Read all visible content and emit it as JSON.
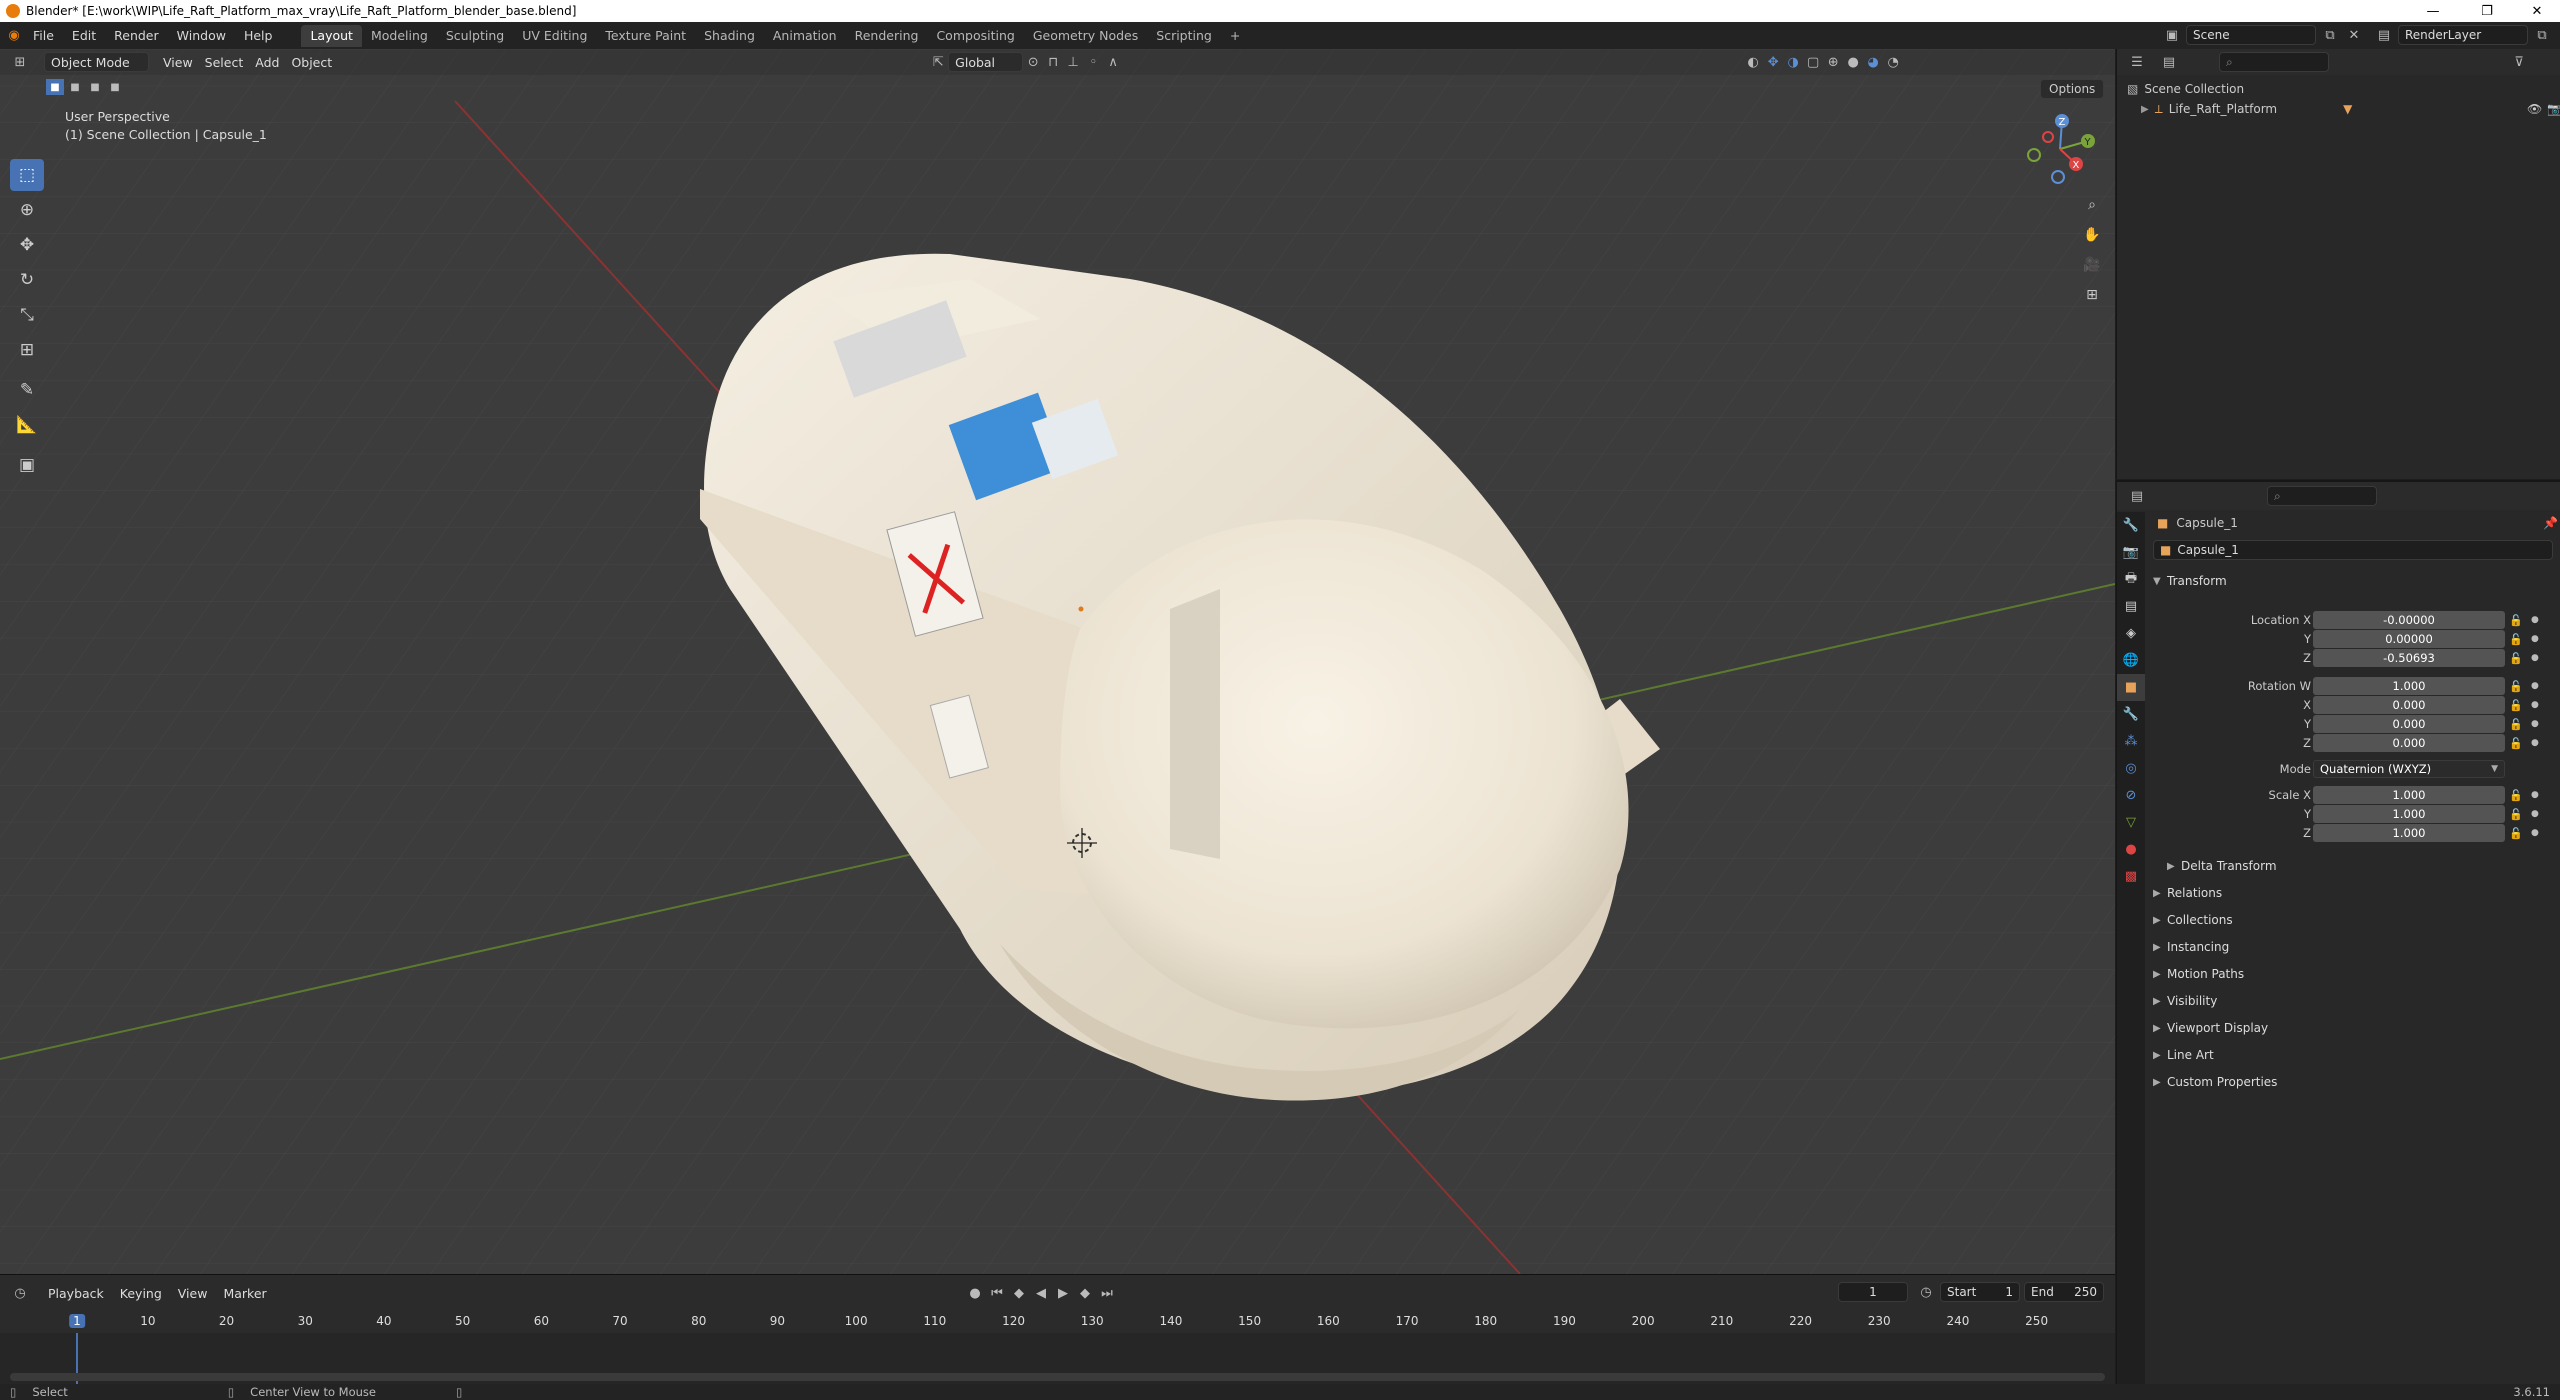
{
  "window": {
    "title": "Blender* [E:\\work\\WIP\\Life_Raft_Platform_max_vray\\Life_Raft_Platform_blender_base.blend]",
    "min": "—",
    "max": "❐",
    "close": "✕"
  },
  "menus": [
    "File",
    "Edit",
    "Render",
    "Window",
    "Help"
  ],
  "workspaces": [
    "Layout",
    "Modeling",
    "Sculpting",
    "UV Editing",
    "Texture Paint",
    "Shading",
    "Animation",
    "Rendering",
    "Compositing",
    "Geometry Nodes",
    "Scripting"
  ],
  "add_workspace": "+",
  "scene": {
    "name": "Scene",
    "view_layer": "RenderLayer"
  },
  "viewport": {
    "mode": "Object Mode",
    "view": "View",
    "select": "Select",
    "add": "Add",
    "object": "Object",
    "transform_orientation": "Global",
    "options": "Options",
    "perspective": "User Perspective",
    "collection_info": "(1) Scene Collection | Capsule_1",
    "gizmo": {
      "x": "X",
      "y": "Y",
      "z": "Z"
    },
    "object_colors": {
      "body": "#eee6d6",
      "shadow": "#c9bfae",
      "floor": "#3a3a3a"
    }
  },
  "outliner": {
    "root": "Scene Collection",
    "items": [
      {
        "name": "Life_Raft_Platform"
      }
    ]
  },
  "properties": {
    "object_name": "Capsule_1",
    "data_name": "Capsule_1",
    "transform_title": "Transform",
    "location": {
      "label": "Location X",
      "x": "-0.00000",
      "y_label": "Y",
      "y": "0.00000",
      "z_label": "Z",
      "z": "-0.50693"
    },
    "rotation": {
      "label": "Rotation W",
      "w": "1.000",
      "x_label": "X",
      "x": "0.000",
      "y_label": "Y",
      "y": "0.000",
      "z_label": "Z",
      "z": "0.000"
    },
    "mode": {
      "label": "Mode",
      "value": "Quaternion (WXYZ)"
    },
    "scale": {
      "label": "Scale X",
      "x": "1.000",
      "y_label": "Y",
      "y": "1.000",
      "z_label": "Z",
      "z": "1.000"
    },
    "delta_transform": "Delta Transform",
    "panels": [
      "Relations",
      "Collections",
      "Instancing",
      "Motion Paths",
      "Visibility",
      "Viewport Display",
      "Line Art",
      "Custom Properties"
    ]
  },
  "timeline": {
    "playback": "Playback",
    "keying": "Keying",
    "view": "View",
    "marker": "Marker",
    "current_frame": "1",
    "start_label": "Start",
    "start": "1",
    "end_label": "End",
    "end": "250",
    "ticks": [
      "1",
      "10",
      "20",
      "30",
      "40",
      "50",
      "60",
      "70",
      "80",
      "90",
      "100",
      "110",
      "120",
      "130",
      "140",
      "150",
      "160",
      "170",
      "180",
      "190",
      "200",
      "210",
      "220",
      "230",
      "240",
      "250"
    ]
  },
  "status": {
    "select": "Select",
    "center_view": "Center View to Mouse",
    "version": "3.6.11"
  }
}
